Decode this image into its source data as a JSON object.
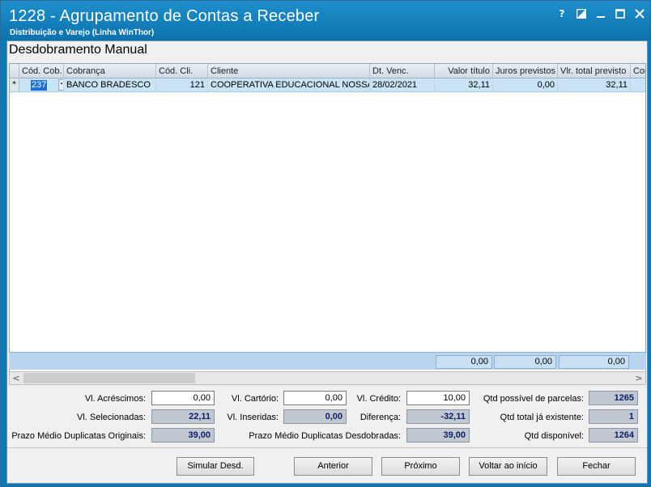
{
  "window": {
    "title": "1228 - Agrupamento de Contas a Receber",
    "subtitle": "Distribuição e Varejo (Linha WinThor)",
    "btn_help": "?",
    "btn_minimize": "–"
  },
  "form": {
    "title": "Desdobramento Manual"
  },
  "grid": {
    "columns": [
      "Cód. Cob.",
      "Cobrança",
      "Cód. Cli.",
      "Cliente",
      "Dt. Venc.",
      "Valor título",
      "Juros previstos",
      "Vlr. total previsto",
      "Con"
    ],
    "row": {
      "marker": "*",
      "cod_cob": "237",
      "ellipsis": "···",
      "cobranca": "BANCO BRADESCO",
      "cod_cli": "121",
      "cliente": "COOPERATIVA EDUCACIONAL NOSSA ESCOLA",
      "dt_venc": "28/02/2021",
      "valor_titulo": "32,11",
      "juros_previstos": "0,00",
      "vlr_total_previsto": "32,11"
    },
    "totals": [
      "0,00",
      "0,00",
      "0,00"
    ]
  },
  "scroll": {
    "left": "<",
    "right": ">"
  },
  "fields": {
    "vl_acrescimos": {
      "label": "Vl. Acréscimos:",
      "value": "0,00"
    },
    "vl_cartorio": {
      "label": "Vl. Cartório:",
      "value": "0,00"
    },
    "vl_credito": {
      "label": "Vl. Crédito:",
      "value": "10,00"
    },
    "qtd_possivel": {
      "label": "Qtd possível de parcelas:",
      "value": "1265"
    },
    "vl_selecionadas": {
      "label": "Vl. Selecionadas:",
      "value": "22,11"
    },
    "vl_inseridas": {
      "label": "Vl. Inseridas:",
      "value": "0,00"
    },
    "diferenca": {
      "label": "Diferença:",
      "value": "-32,11"
    },
    "qtd_existente": {
      "label": "Qtd total já existente:",
      "value": "1"
    },
    "prazo_originais": {
      "label": "Prazo Médio Duplicatas Originais:",
      "value": "39,00"
    },
    "prazo_desdobradas": {
      "label": "Prazo Médio Duplicatas Desdobradas:",
      "value": "39,00"
    },
    "qtd_disponivel": {
      "label": "Qtd disponível:",
      "value": "1264"
    }
  },
  "buttons": {
    "simular": "Simular Desd.",
    "anterior": "Anterior",
    "proximo": "Próximo",
    "voltar": "Voltar ao início",
    "fechar": "Fechar"
  },
  "colors": {
    "title_bar": "#0a7ab8",
    "row_selected": "#c9e3f7",
    "readonly_field": "#c2c8d2"
  }
}
